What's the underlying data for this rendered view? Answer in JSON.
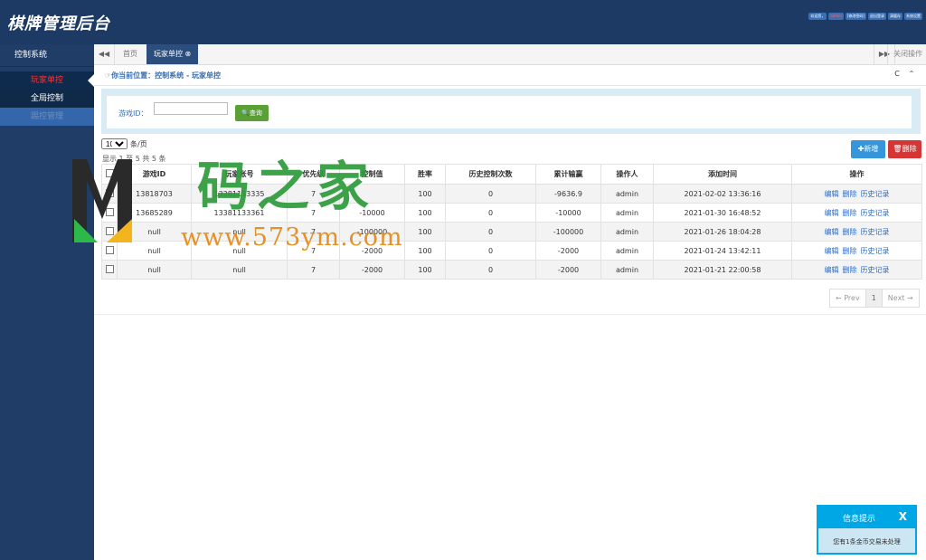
{
  "header": {
    "logo": "棋牌管理后台",
    "links": [
      "欢迎您，",
      "admin",
      "[修改密码]",
      "退出登录",
      "清缓存",
      "系统设置"
    ]
  },
  "sidebar": {
    "title": "控制系统",
    "items": [
      {
        "label": "玩家单控"
      },
      {
        "label": "全局控制"
      },
      {
        "label": "踢控管理"
      }
    ]
  },
  "tabs": {
    "prev_icon": "◀◀",
    "next_icon": "▶▶",
    "items": [
      {
        "label": "首页"
      },
      {
        "label": "玩家单控 ⊗"
      }
    ],
    "close_ops": "关闭操作"
  },
  "breadcrumb": {
    "text": "☞你当前位置：控制系统 - 玩家单控",
    "refresh_icon": "C",
    "collapse_icon": "⌃"
  },
  "search": {
    "label": "游戏ID：",
    "value": "",
    "placeholder": "",
    "button": "🔍查询"
  },
  "list": {
    "page_size": "10",
    "page_size_suffix": "条/页",
    "summary": "显示 1 至 5 共 5 条",
    "add_button": "✚新增",
    "delete_button": "🗑删除",
    "columns": [
      "",
      "游戏ID",
      "玩家账号",
      "优先级",
      "控制值",
      "胜率",
      "历史控制次数",
      "累计输赢",
      "操作人",
      "添加时间",
      "操作"
    ],
    "rows": [
      {
        "id": "13818703",
        "account": "13381153335",
        "priority": "7",
        "value": "",
        "winrate": "100",
        "history": "0",
        "total": "-9636.9",
        "operator": "admin",
        "time": "2021-02-02 13:36:16"
      },
      {
        "id": "13685289",
        "account": "13381133361",
        "priority": "7",
        "value": "-10000",
        "winrate": "100",
        "history": "0",
        "total": "-10000",
        "operator": "admin",
        "time": "2021-01-30 16:48:52"
      },
      {
        "id": "null",
        "account": "null",
        "priority": "7",
        "value": "-100000",
        "winrate": "100",
        "history": "0",
        "total": "-100000",
        "operator": "admin",
        "time": "2021-01-26 18:04:28"
      },
      {
        "id": "null",
        "account": "null",
        "priority": "7",
        "value": "-2000",
        "winrate": "100",
        "history": "0",
        "total": "-2000",
        "operator": "admin",
        "time": "2021-01-24 13:42:11"
      },
      {
        "id": "null",
        "account": "null",
        "priority": "7",
        "value": "-2000",
        "winrate": "100",
        "history": "0",
        "total": "-2000",
        "operator": "admin",
        "time": "2021-01-21 22:00:58"
      }
    ],
    "actions": [
      "编辑",
      "删除",
      "历史记录"
    ]
  },
  "pager": {
    "prev": "← Prev",
    "current": "1",
    "next": "Next →"
  },
  "watermark": {
    "text": "码之家",
    "url": "www.573ym.com"
  },
  "notice": {
    "title": "信息提示",
    "close": "X",
    "body": "您有1条金币交易未处理"
  }
}
